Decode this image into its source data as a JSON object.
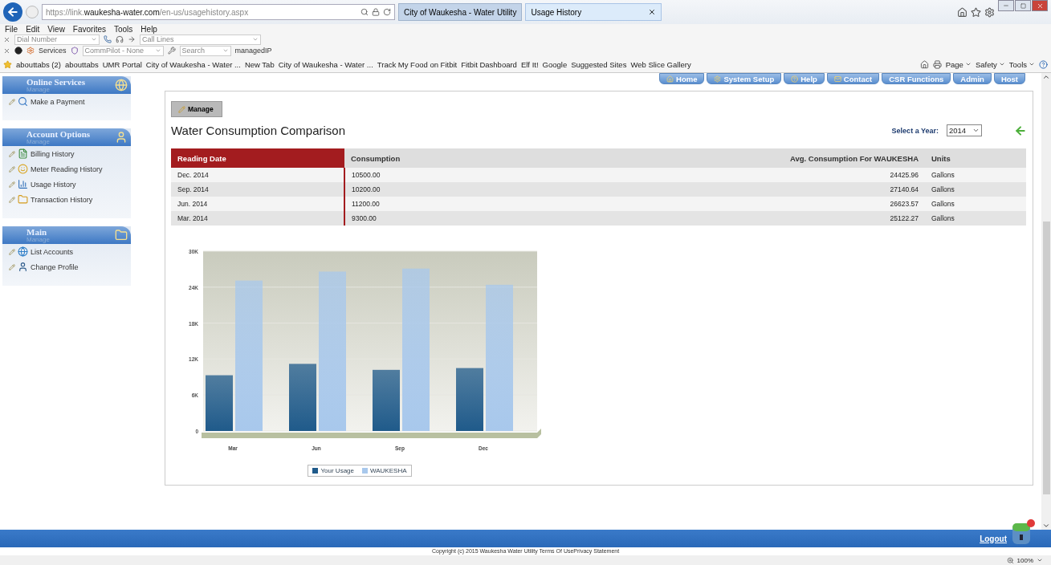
{
  "browser": {
    "url_prefix": "https://link.",
    "url_host": "waukesha-water.com",
    "url_path": "/en-us/usagehistory.aspx",
    "tabs": [
      {
        "label": "City of Waukesha - Water Utility",
        "selected": false
      },
      {
        "label": "Usage History",
        "selected": true
      }
    ],
    "menu": [
      "File",
      "Edit",
      "View",
      "Favorites",
      "Tools",
      "Help"
    ],
    "dial_placeholder": "Dial Number",
    "call_lines": "Call Lines",
    "services": "Services",
    "commpilot": "CommPilot - None",
    "search_placeholder": "Search",
    "managed": "managedIP",
    "favorites": [
      "abouttabs (2)",
      "abouttabs",
      "UMR Portal",
      "City of Waukesha - Water ...",
      "New Tab",
      "City of Waukesha - Water ...",
      "Track My Food on Fitbit",
      "Fitbit Dashboard",
      "Elf It!",
      "Google",
      "Suggested Sites",
      "Web Slice Gallery"
    ],
    "commands": [
      "Page",
      "Safety",
      "Tools"
    ]
  },
  "nav": [
    "Home",
    "System Setup",
    "Help",
    "Contact",
    "CSR Functions",
    "Admin",
    "Host"
  ],
  "sidebar": [
    {
      "title": "Online Services",
      "subtitle": "Manage",
      "items": [
        "Make a Payment"
      ]
    },
    {
      "title": "Account Options",
      "subtitle": "Manage",
      "items": [
        "Billing History",
        "Meter Reading History",
        "Usage History",
        "Transaction History"
      ]
    },
    {
      "title": "Main",
      "subtitle": "Manage",
      "items": [
        "List Accounts",
        "Change Profile"
      ]
    }
  ],
  "main": {
    "manage_button": "Manage",
    "title": "Water Consumption Comparison",
    "year_label": "Select a Year:",
    "year_value": "2014",
    "table": {
      "columns": [
        "Reading Date",
        "Consumption",
        "Avg. Consumption For WAUKESHA",
        "Units"
      ],
      "rows": [
        [
          "Dec. 2014",
          "10500.00",
          "24425.96",
          "Gallons"
        ],
        [
          "Sep. 2014",
          "10200.00",
          "27140.64",
          "Gallons"
        ],
        [
          "Jun. 2014",
          "11200.00",
          "26623.57",
          "Gallons"
        ],
        [
          "Mar. 2014",
          "9300.00",
          "25122.27",
          "Gallons"
        ]
      ]
    },
    "chart_data": {
      "type": "bar",
      "categories": [
        "Mar",
        "Jun",
        "Sep",
        "Dec"
      ],
      "series": [
        {
          "name": "Your Usage",
          "color": "#1f5a8a",
          "values": [
            9300,
            11200,
            10200,
            10500
          ]
        },
        {
          "name": "WAUKESHA",
          "color": "#a8c8ec",
          "values": [
            25100,
            26600,
            27100,
            24400
          ]
        }
      ],
      "ylim": [
        0,
        30000
      ],
      "yticks": [
        {
          "value": 0,
          "label": "0"
        },
        {
          "value": 6000,
          "label": "6K"
        },
        {
          "value": 12000,
          "label": "12K"
        },
        {
          "value": 18000,
          "label": "18K"
        },
        {
          "value": 24000,
          "label": "24K"
        },
        {
          "value": 30000,
          "label": "30K"
        }
      ]
    }
  },
  "footer": {
    "logout": "Logout",
    "copyright": "Copyright (c) 2015 Waukesha Water Utility Terms Of UsePrivacy Statement",
    "zoom": "100%"
  }
}
